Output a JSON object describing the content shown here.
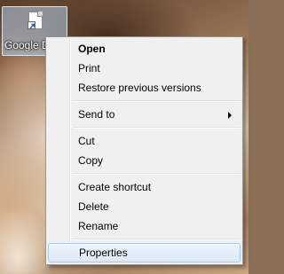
{
  "desktop": {
    "icon": {
      "label": "Google D",
      "icon_name": "document-shortcut-icon"
    }
  },
  "context_menu": {
    "open": "Open",
    "print": "Print",
    "restore": "Restore previous versions",
    "send_to": "Send to",
    "cut": "Cut",
    "copy": "Copy",
    "create_shortcut": "Create shortcut",
    "delete": "Delete",
    "rename": "Rename",
    "properties": "Properties"
  }
}
